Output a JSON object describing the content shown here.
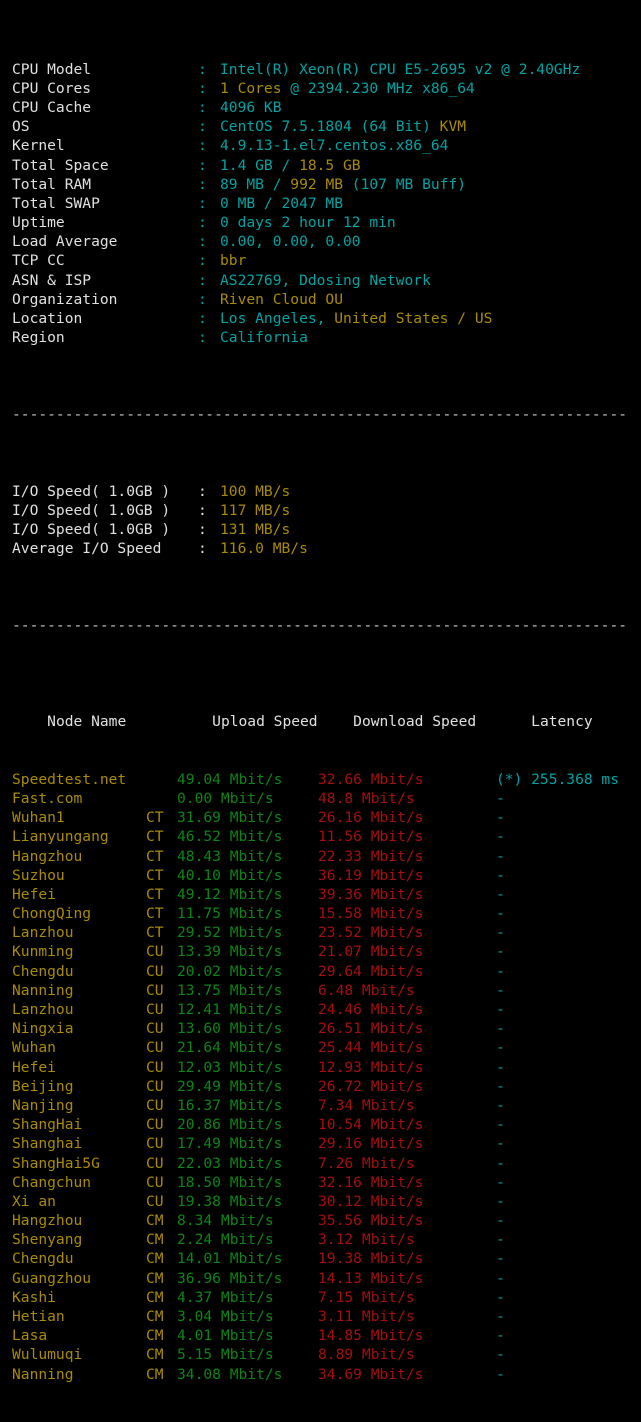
{
  "sysinfo": {
    "rows": [
      {
        "label": "CPU Model",
        "colon": ":",
        "value_primary": "Intel(R) Xeon(R) CPU E5-2695 v2 @ 2.40GHz",
        "value_accent": ""
      },
      {
        "label": "CPU Cores",
        "colon": ":",
        "value_primary": "1 Cores",
        "value_accent": " @ 2394.230 MHz x86_64",
        "accent_first": true
      },
      {
        "label": "CPU Cache",
        "colon": ":",
        "value_primary": "4096 KB",
        "value_accent": ""
      },
      {
        "label": "OS",
        "colon": ":",
        "value_primary": "CentOS 7.5.1804 (64 Bit) ",
        "value_accent": "KVM"
      },
      {
        "label": "Kernel",
        "colon": ":",
        "value_primary": "4.9.13-1.el7.centos.x86_64",
        "value_accent": ""
      },
      {
        "label": "Total Space",
        "colon": ":",
        "value_primary": "1.4 GB / ",
        "value_accent": "18.5 GB"
      },
      {
        "label": "Total RAM",
        "colon": ":",
        "value_primary": "89 MB / ",
        "value_accent": "992 MB",
        "value_tail": " (107 MB Buff)"
      },
      {
        "label": "Total SWAP",
        "colon": ":",
        "value_primary": "0 MB / 2047 MB",
        "value_accent": ""
      },
      {
        "label": "Uptime",
        "colon": ":",
        "value_primary": "0 days 2 hour 12 min",
        "value_accent": ""
      },
      {
        "label": "Load Average",
        "colon": ":",
        "value_primary": "0.00, 0.00, 0.00",
        "value_accent": ""
      },
      {
        "label": "TCP CC",
        "colon": ":",
        "value_primary": "",
        "value_accent": "bbr"
      },
      {
        "label": "ASN & ISP",
        "colon": ":",
        "value_primary": "AS22769, Ddosing Network",
        "value_accent": ""
      },
      {
        "label": "Organization",
        "colon": ":",
        "value_primary": "",
        "value_accent": "Riven Cloud OU"
      },
      {
        "label": "Location",
        "colon": ":",
        "value_primary": "Los Angeles, ",
        "value_accent": "United States / US"
      },
      {
        "label": "Region",
        "colon": ":",
        "value_primary": "California",
        "value_accent": ""
      }
    ]
  },
  "separator": "----------------------------------------------------------------------",
  "iotest": {
    "rows": [
      {
        "label": "I/O Speed( 1.0GB )",
        "colon": ":",
        "value": "100 MB/s"
      },
      {
        "label": "I/O Speed( 1.0GB )",
        "colon": ":",
        "value": "117 MB/s"
      },
      {
        "label": "I/O Speed( 1.0GB )",
        "colon": ":",
        "value": "131 MB/s"
      },
      {
        "label": "Average I/O Speed",
        "colon": ":",
        "value": "116.0 MB/s"
      }
    ]
  },
  "speedtest": {
    "headers": {
      "node": "Node Name",
      "upload": "Upload Speed",
      "download": "Download Speed",
      "latency": "Latency"
    },
    "rows": [
      {
        "node": "Speedtest.net",
        "isp": "",
        "upload": "49.04 Mbit/s",
        "download": "32.66 Mbit/s",
        "latency": "(*) 255.368 ms"
      },
      {
        "node": "Fast.com",
        "isp": "",
        "upload": "0.00 Mbit/s",
        "download": "48.8 Mbit/s",
        "latency": "-"
      },
      {
        "node": "Wuhan1",
        "isp": "CT",
        "upload": "31.69 Mbit/s",
        "download": "26.16 Mbit/s",
        "latency": "-"
      },
      {
        "node": "Lianyungang",
        "isp": "CT",
        "upload": "46.52 Mbit/s",
        "download": "11.56 Mbit/s",
        "latency": "-"
      },
      {
        "node": "Hangzhou",
        "isp": "CT",
        "upload": "48.43 Mbit/s",
        "download": "22.33 Mbit/s",
        "latency": "-"
      },
      {
        "node": "Suzhou",
        "isp": "CT",
        "upload": "40.10 Mbit/s",
        "download": "36.19 Mbit/s",
        "latency": "-"
      },
      {
        "node": "Hefei",
        "isp": "CT",
        "upload": "49.12 Mbit/s",
        "download": "39.36 Mbit/s",
        "latency": "-"
      },
      {
        "node": "ChongQing",
        "isp": "CT",
        "upload": "11.75 Mbit/s",
        "download": "15.58 Mbit/s",
        "latency": "-"
      },
      {
        "node": "Lanzhou",
        "isp": "CT",
        "upload": "29.52 Mbit/s",
        "download": "23.52 Mbit/s",
        "latency": "-"
      },
      {
        "node": "Kunming",
        "isp": "CU",
        "upload": "13.39 Mbit/s",
        "download": "21.07 Mbit/s",
        "latency": "-"
      },
      {
        "node": "Chengdu",
        "isp": "CU",
        "upload": "20.02 Mbit/s",
        "download": "29.64 Mbit/s",
        "latency": "-"
      },
      {
        "node": "Nanning",
        "isp": "CU",
        "upload": "13.75 Mbit/s",
        "download": "6.48 Mbit/s",
        "latency": "-"
      },
      {
        "node": "Lanzhou",
        "isp": "CU",
        "upload": "12.41 Mbit/s",
        "download": "24.46 Mbit/s",
        "latency": "-"
      },
      {
        "node": "Ningxia",
        "isp": "CU",
        "upload": "13.60 Mbit/s",
        "download": "26.51 Mbit/s",
        "latency": "-"
      },
      {
        "node": "Wuhan",
        "isp": "CU",
        "upload": "21.64 Mbit/s",
        "download": "25.44 Mbit/s",
        "latency": "-"
      },
      {
        "node": "Hefei",
        "isp": "CU",
        "upload": "12.03 Mbit/s",
        "download": "12.93 Mbit/s",
        "latency": "-"
      },
      {
        "node": "Beijing",
        "isp": "CU",
        "upload": "29.49 Mbit/s",
        "download": "26.72 Mbit/s",
        "latency": "-"
      },
      {
        "node": "Nanjing",
        "isp": "CU",
        "upload": "16.37 Mbit/s",
        "download": "7.34 Mbit/s",
        "latency": "-"
      },
      {
        "node": "ShangHai",
        "isp": "CU",
        "upload": "20.86 Mbit/s",
        "download": "10.54 Mbit/s",
        "latency": "-"
      },
      {
        "node": "Shanghai",
        "isp": "CU",
        "upload": "17.49 Mbit/s",
        "download": "29.16 Mbit/s",
        "latency": "-"
      },
      {
        "node": "ShangHai5G",
        "isp": "CU",
        "upload": "22.03 Mbit/s",
        "download": "7.26 Mbit/s",
        "latency": "-"
      },
      {
        "node": "Changchun",
        "isp": "CU",
        "upload": "18.50 Mbit/s",
        "download": "32.16 Mbit/s",
        "latency": "-"
      },
      {
        "node": "Xi an",
        "isp": "CU",
        "upload": "19.38 Mbit/s",
        "download": "30.12 Mbit/s",
        "latency": "-"
      },
      {
        "node": "Hangzhou",
        "isp": "CM",
        "upload": "8.34 Mbit/s",
        "download": "35.56 Mbit/s",
        "latency": "-"
      },
      {
        "node": "Shenyang",
        "isp": "CM",
        "upload": "2.24 Mbit/s",
        "download": "3.12 Mbit/s",
        "latency": "-"
      },
      {
        "node": "Chengdu",
        "isp": "CM",
        "upload": "14.01 Mbit/s",
        "download": "19.38 Mbit/s",
        "latency": "-"
      },
      {
        "node": "Guangzhou",
        "isp": "CM",
        "upload": "36.96 Mbit/s",
        "download": "14.13 Mbit/s",
        "latency": "-"
      },
      {
        "node": "Kashi",
        "isp": "CM",
        "upload": "4.37 Mbit/s",
        "download": "7.15 Mbit/s",
        "latency": "-"
      },
      {
        "node": "Hetian",
        "isp": "CM",
        "upload": "3.04 Mbit/s",
        "download": "3.11 Mbit/s",
        "latency": "-"
      },
      {
        "node": "Lasa",
        "isp": "CM",
        "upload": "4.01 Mbit/s",
        "download": "14.85 Mbit/s",
        "latency": "-"
      },
      {
        "node": "Wulumuqi",
        "isp": "CM",
        "upload": "5.15 Mbit/s",
        "download": "8.89 Mbit/s",
        "latency": "-"
      },
      {
        "node": "Nanning",
        "isp": "CM",
        "upload": "34.08 Mbit/s",
        "download": "34.69 Mbit/s",
        "latency": "-"
      }
    ]
  },
  "colors": {
    "background": "#000000",
    "label": "#e0e0e0",
    "cyan": "#00a3a3",
    "yellow": "#a88b00",
    "green": "#0c8416",
    "red": "#a50e0e",
    "separator": "#c9c9c9"
  }
}
